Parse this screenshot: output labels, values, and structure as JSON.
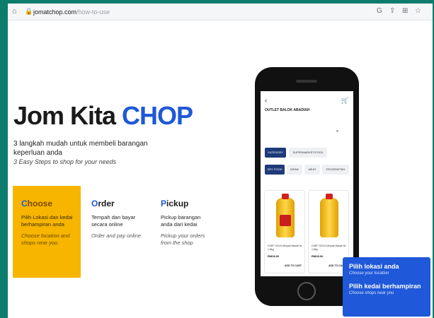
{
  "browser": {
    "url_domain": "jomatchop.com",
    "url_path": "/how-to-use"
  },
  "hero": {
    "title_prefix": "Jom Kita ",
    "title_brand": "CHOP",
    "subtitle": "3 langkah mudah untuk membeli barangan keperluan anda",
    "subtitle_en": "3 Easy Steps to shop for your needs"
  },
  "steps": [
    {
      "title_lead": "C",
      "title_rest": "hoose",
      "text": "Pilih Lokasi dan kedai berhampiran anda",
      "text_en": "Choose location and shops near you"
    },
    {
      "title_lead": "O",
      "title_rest": "rder",
      "text": "Tempah dan bayar secara online",
      "text_en": "Order and pay online"
    },
    {
      "title_lead": "P",
      "title_rest": "ickup",
      "text": "Pickup barangan anda dari kedai",
      "text_en": "Pickup your orders from the shop"
    }
  ],
  "phone": {
    "outlet_title": "OUTLET BALOK ABADIAH",
    "chips": [
      "CATEGORY",
      "SUPERMARKET/FOOD",
      "DRY FOOD",
      "DRINK",
      "MEAT",
      "FROZEN/FISH"
    ],
    "products": [
      {
        "name": "CHEF GOLD Minyak Masak 5x 1.8kg",
        "price": "RM28.00",
        "cta": "ADD TO CART"
      },
      {
        "name": "CHEF GOLD Minyak Masak 5x 1.8kg",
        "price": "RM28.00",
        "cta": "ADD TO CART"
      }
    ]
  },
  "popup": {
    "line1": "Pilih lokasi anda",
    "line1_en": "Choose your location",
    "line2": "Pilih kedai berhampiran",
    "line2_en": "Choose shops near you"
  }
}
